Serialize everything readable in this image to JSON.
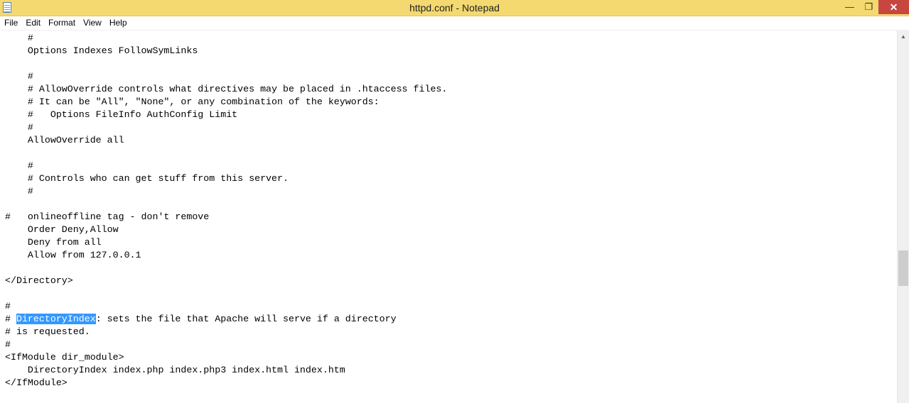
{
  "window": {
    "title": "httpd.conf - Notepad",
    "min_symbol": "—",
    "max_symbol": "❐",
    "close_symbol": "✕"
  },
  "menu": {
    "items": [
      "File",
      "Edit",
      "Format",
      "View",
      "Help"
    ]
  },
  "editor": {
    "lines": [
      "    #",
      "    Options Indexes FollowSymLinks",
      "",
      "    #",
      "    # AllowOverride controls what directives may be placed in .htaccess files.",
      "    # It can be \"All\", \"None\", or any combination of the keywords:",
      "    #   Options FileInfo AuthConfig Limit",
      "    #",
      "    AllowOverride all",
      "",
      "    #",
      "    # Controls who can get stuff from this server.",
      "    #",
      "",
      "#   onlineoffline tag - don't remove",
      "    Order Deny,Allow",
      "    Deny from all",
      "    Allow from 127.0.0.1",
      "",
      "</Directory>",
      "",
      "#",
      "# DirectoryIndex: sets the file that Apache will serve if a directory",
      "# is requested.",
      "#",
      "<IfModule dir_module>",
      "    DirectoryIndex index.php index.php3 index.html index.htm",
      "</IfModule>"
    ],
    "selected_line": {
      "before": "# ",
      "selected": "DirectoryIndex",
      "after": ": sets the file that Apache will serve if a directory"
    }
  },
  "scrollbar": {
    "up_arrow": "▲"
  }
}
